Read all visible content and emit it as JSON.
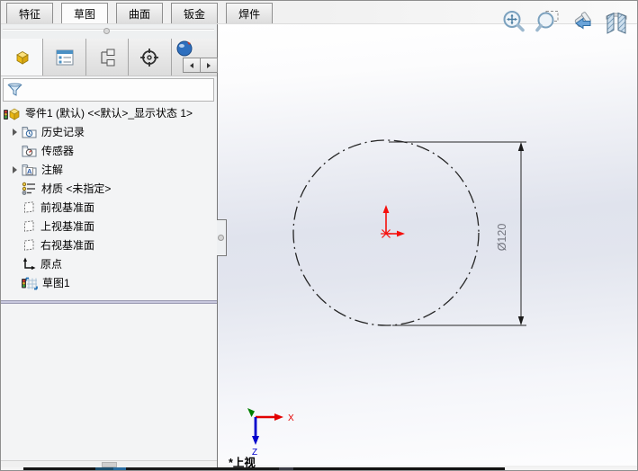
{
  "command_tabs": {
    "items": [
      {
        "label": "特征",
        "active": false
      },
      {
        "label": "草图",
        "active": true
      },
      {
        "label": "曲面",
        "active": false
      },
      {
        "label": "钣金",
        "active": false
      },
      {
        "label": "焊件",
        "active": false
      }
    ]
  },
  "headsup": {
    "icons": [
      {
        "name": "zoom-to-fit"
      },
      {
        "name": "zoom-to-area"
      },
      {
        "name": "previous-view"
      },
      {
        "name": "section-view"
      }
    ]
  },
  "panel": {
    "tabs": [
      {
        "name": "featuremanager",
        "active": true
      },
      {
        "name": "propertymanager",
        "active": false
      },
      {
        "name": "configurationmanager",
        "active": false
      },
      {
        "name": "dimxpertmanager",
        "active": false
      },
      {
        "name": "displaymanager",
        "active": false
      }
    ],
    "tree": {
      "root": {
        "label": "零件1 (默认) <<默认>_显示状态 1>",
        "icon": "part-icon"
      },
      "items": [
        {
          "label": "历史记录",
          "icon": "history-folder-icon",
          "expandable": true
        },
        {
          "label": "传感器",
          "icon": "sensors-folder-icon",
          "expandable": false
        },
        {
          "label": "注解",
          "icon": "annotations-folder-icon",
          "expandable": true
        },
        {
          "label": "材质 <未指定>",
          "icon": "material-icon",
          "expandable": false
        },
        {
          "label": "前视基准面",
          "icon": "plane-icon",
          "expandable": false
        },
        {
          "label": "上视基准面",
          "icon": "plane-icon",
          "expandable": false
        },
        {
          "label": "右视基准面",
          "icon": "plane-icon",
          "expandable": false
        },
        {
          "label": "原点",
          "icon": "origin-icon",
          "expandable": false
        },
        {
          "label": "草图1",
          "icon": "sketch-icon",
          "expandable": false
        }
      ]
    }
  },
  "viewport": {
    "view_label": "*上视",
    "dimension_label": "Ø120",
    "triad": {
      "x_label": "X",
      "z_label": "Z"
    },
    "sketch": {
      "entity": "construction-circle",
      "diameter": 120,
      "line_style": "dash-dot"
    }
  },
  "colors": {
    "selection_red": "#e20000",
    "dimension_text": "#73757f",
    "sketch_line": "#252525",
    "viewport_center": "#e0e3ed",
    "triad_x": "#e20000",
    "triad_z": "#0000cc",
    "triad_y": "#007f00"
  }
}
